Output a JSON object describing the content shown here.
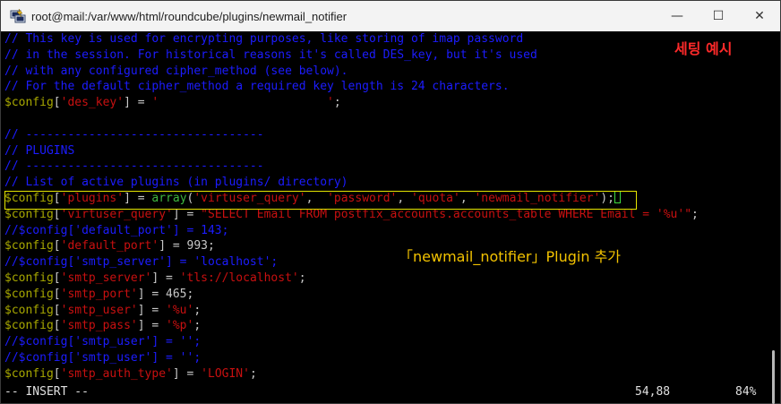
{
  "window": {
    "title": "root@mail:/var/www/html/roundcube/plugins/newmail_notifier",
    "minimize_glyph": "—",
    "maximize_glyph": "☐",
    "close_glyph": "✕"
  },
  "lines": [
    [
      {
        "t": "// This key is used for encrypting purposes, like storing of imap password",
        "c": "com"
      }
    ],
    [
      {
        "t": "// in the session. For historical reasons it's called DES_key, but it's used",
        "c": "com"
      }
    ],
    [
      {
        "t": "// with any configured cipher_method (see below).",
        "c": "com"
      }
    ],
    [
      {
        "t": "// For the default cipher_method a required key length is 24 characters.",
        "c": "com"
      }
    ],
    [
      {
        "t": "$config",
        "c": "var"
      },
      {
        "t": "[",
        "c": "op"
      },
      {
        "t": "'des_key'",
        "c": "str"
      },
      {
        "t": "] = ",
        "c": "op"
      },
      {
        "t": "'                        '",
        "c": "str"
      },
      {
        "t": ";",
        "c": "op"
      }
    ],
    [
      {
        "t": "",
        "c": "op"
      }
    ],
    [
      {
        "t": "// ----------------------------------",
        "c": "com"
      }
    ],
    [
      {
        "t": "// PLUGINS",
        "c": "com"
      }
    ],
    [
      {
        "t": "// ----------------------------------",
        "c": "com"
      }
    ],
    [
      {
        "t": "// List of active plugins (in plugins/ directory)",
        "c": "com"
      }
    ],
    [
      {
        "t": "$config",
        "c": "var"
      },
      {
        "t": "[",
        "c": "op"
      },
      {
        "t": "'plugins'",
        "c": "str"
      },
      {
        "t": "] = ",
        "c": "op"
      },
      {
        "t": "array",
        "c": "fn"
      },
      {
        "t": "(",
        "c": "op"
      },
      {
        "t": "'virtuser_query'",
        "c": "str"
      },
      {
        "t": ",  ",
        "c": "op"
      },
      {
        "t": "'password'",
        "c": "str"
      },
      {
        "t": ", ",
        "c": "op"
      },
      {
        "t": "'quota'",
        "c": "str"
      },
      {
        "t": ", ",
        "c": "op"
      },
      {
        "t": "'newmail_notifier'",
        "c": "str"
      },
      {
        "t": ");",
        "c": "op"
      },
      {
        "t": "__CURSOR__",
        "c": "cursor"
      }
    ],
    [
      {
        "t": "$config",
        "c": "var"
      },
      {
        "t": "[",
        "c": "op"
      },
      {
        "t": "'virtuser_query'",
        "c": "str"
      },
      {
        "t": "] = ",
        "c": "op"
      },
      {
        "t": "\"SELECT Email FROM postfix_accounts.accounts_table WHERE Email = '%u'\"",
        "c": "str"
      },
      {
        "t": ";",
        "c": "op"
      }
    ],
    [
      {
        "t": "//$config['default_port'] = 143;",
        "c": "com"
      }
    ],
    [
      {
        "t": "$config",
        "c": "var"
      },
      {
        "t": "[",
        "c": "op"
      },
      {
        "t": "'default_port'",
        "c": "str"
      },
      {
        "t": "] = 993;",
        "c": "op"
      }
    ],
    [
      {
        "t": "//$config['smtp_server'] = 'localhost';",
        "c": "com"
      }
    ],
    [
      {
        "t": "$config",
        "c": "var"
      },
      {
        "t": "[",
        "c": "op"
      },
      {
        "t": "'smtp_server'",
        "c": "str"
      },
      {
        "t": "] = ",
        "c": "op"
      },
      {
        "t": "'tls://localhost'",
        "c": "str"
      },
      {
        "t": ";",
        "c": "op"
      }
    ],
    [
      {
        "t": "$config",
        "c": "var"
      },
      {
        "t": "[",
        "c": "op"
      },
      {
        "t": "'smtp_port'",
        "c": "str"
      },
      {
        "t": "] = 465;",
        "c": "op"
      }
    ],
    [
      {
        "t": "$config",
        "c": "var"
      },
      {
        "t": "[",
        "c": "op"
      },
      {
        "t": "'smtp_user'",
        "c": "str"
      },
      {
        "t": "] = ",
        "c": "op"
      },
      {
        "t": "'%u'",
        "c": "str"
      },
      {
        "t": ";",
        "c": "op"
      }
    ],
    [
      {
        "t": "$config",
        "c": "var"
      },
      {
        "t": "[",
        "c": "op"
      },
      {
        "t": "'smtp_pass'",
        "c": "str"
      },
      {
        "t": "] = ",
        "c": "op"
      },
      {
        "t": "'%p'",
        "c": "str"
      },
      {
        "t": ";",
        "c": "op"
      }
    ],
    [
      {
        "t": "//$config['smtp_user'] = '';",
        "c": "com"
      }
    ],
    [
      {
        "t": "//$config['smtp_user'] = '';",
        "c": "com"
      }
    ],
    [
      {
        "t": "$config",
        "c": "var"
      },
      {
        "t": "[",
        "c": "op"
      },
      {
        "t": "'smtp_auth_type'",
        "c": "str"
      },
      {
        "t": "] = ",
        "c": "op"
      },
      {
        "t": "'LOGIN'",
        "c": "str"
      },
      {
        "t": ";",
        "c": "op"
      }
    ]
  ],
  "status": {
    "mode": "-- INSERT --",
    "position": "54,88",
    "percent": "84%"
  },
  "annotations": {
    "top_label": "세팅 예시",
    "plugin_note": "「newmail_notifier」Plugin 추가"
  },
  "colors": {
    "comment": "#1c1cff",
    "variable": "#a8a800",
    "string": "#c81010",
    "function": "#3fb83f",
    "highlight_box": "#e6e600",
    "annotation_red": "#ff2a2a",
    "annotation_yellow": "#f2c200"
  },
  "icons": {
    "app": "putty-icon"
  }
}
